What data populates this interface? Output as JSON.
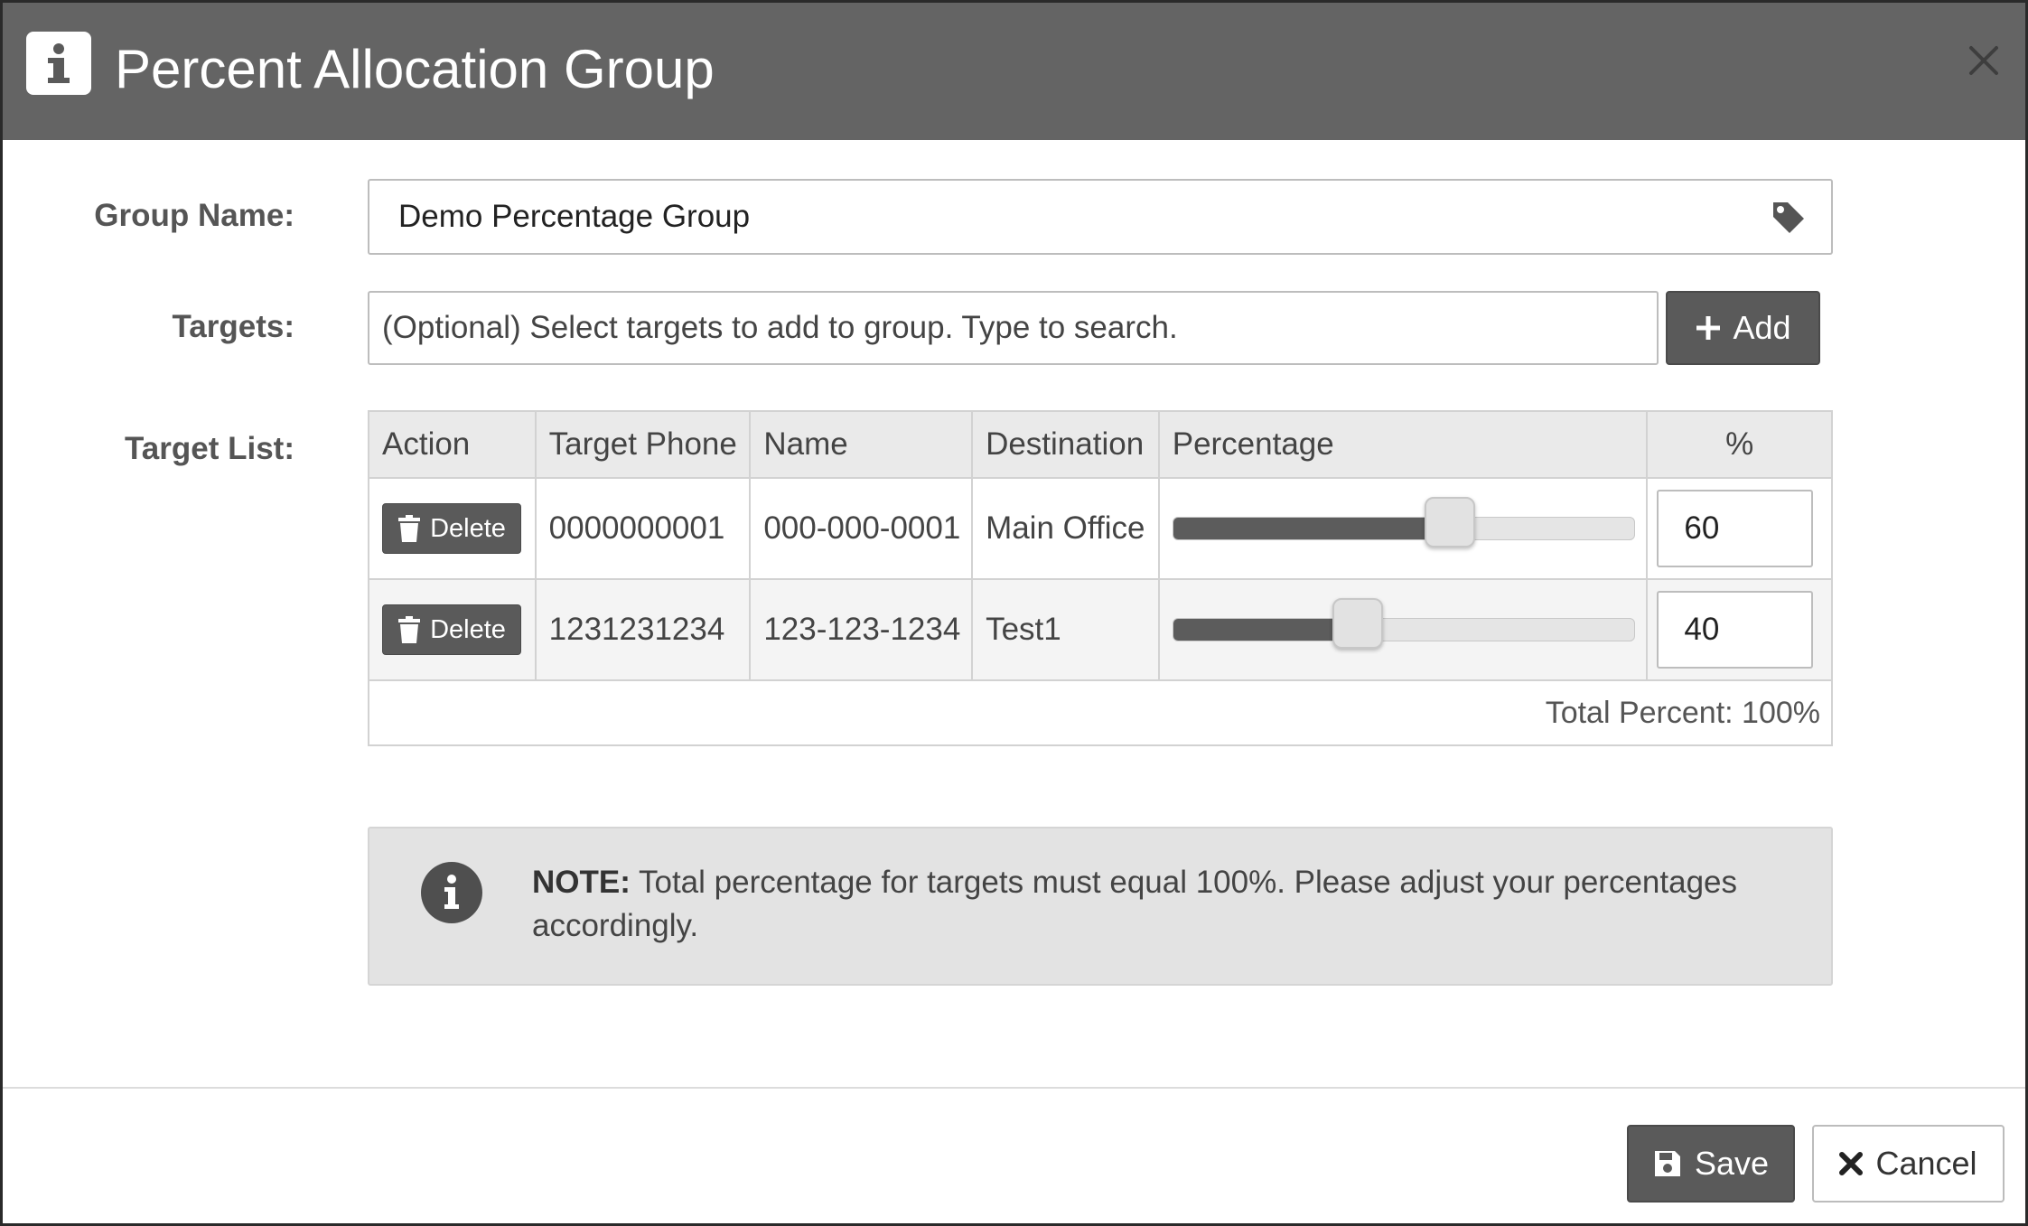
{
  "dialog": {
    "title": "Percent Allocation Group",
    "title_icon": "info-icon",
    "close_icon": "close-icon"
  },
  "form": {
    "group_name_label": "Group Name:",
    "group_name_value": "Demo Percentage Group",
    "group_name_icon": "tag-icon",
    "targets_label": "Targets:",
    "targets_placeholder": "(Optional) Select targets to add to group. Type to search.",
    "add_label": "Add",
    "add_icon": "plus-icon",
    "target_list_label": "Target List:"
  },
  "table": {
    "headers": [
      "Action",
      "Target Phone",
      "Name",
      "Destination",
      "Percentage",
      "%"
    ],
    "rows": [
      {
        "action": "Delete",
        "target_phone": "0000000001",
        "name": "000-000-0001",
        "destination": "Main Office",
        "percent_value": "60",
        "slider_fraction": 0.6
      },
      {
        "action": "Delete",
        "target_phone": "1231231234",
        "name": "123-123-1234",
        "destination": "Test1",
        "percent_value": "40",
        "slider_fraction": 0.4
      }
    ],
    "total_label": "Total Percent: 100%"
  },
  "note": {
    "icon": "info-circle-icon",
    "bold_prefix": "NOTE:",
    "text": " Total percentage for targets must equal 100%. Please adjust your percentages accordingly."
  },
  "footer": {
    "save_label": "Save",
    "save_icon": "save-icon",
    "cancel_label": "Cancel",
    "cancel_icon": "x-icon"
  },
  "colors": {
    "header_bg": "#646464",
    "button_bg": "#5a5a5a",
    "note_bg": "#e3e3e3"
  }
}
